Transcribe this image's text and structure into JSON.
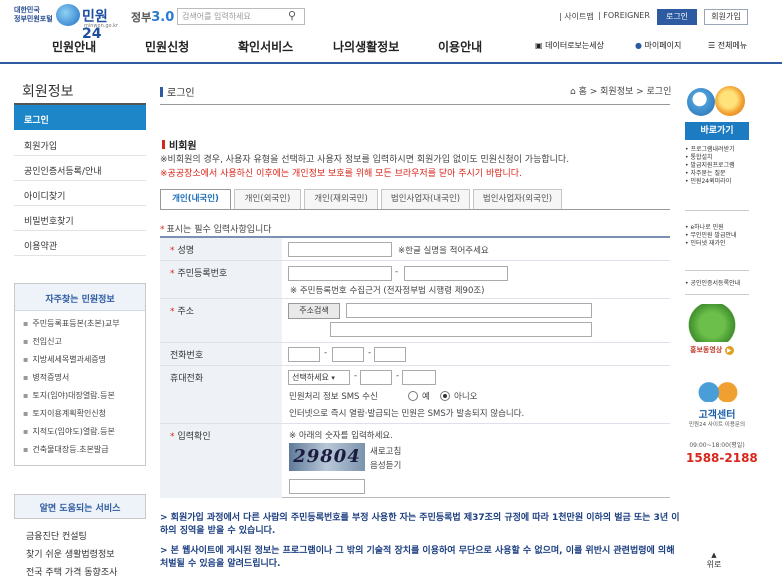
{
  "header": {
    "logo_small": "대한민국\n정부민원포털",
    "logo_text": "민원24",
    "logo_sub": "minwon.go.kr",
    "gov30_prefix": "정부",
    "gov30_mark": "3.0",
    "search_placeholder": "검색어를 입력하세요",
    "util_links": [
      "사이트맵",
      "FOREIGNER"
    ],
    "login_label": "로그인",
    "join_label": "회원가입"
  },
  "gnb": {
    "items": [
      "민원안내",
      "민원신청",
      "확인서비스",
      "나의생활정보",
      "이용안내"
    ],
    "util": [
      "데이터로보는세상",
      "마이페이지",
      "전체메뉴"
    ]
  },
  "lnb": {
    "title": "회원정보",
    "items": [
      "로그인",
      "회원가입",
      "공인인증서등록/안내",
      "아이디찾기",
      "비밀번호찾기",
      "이용약관"
    ],
    "active_index": 0,
    "box1_title": "자주찾는 민원정보",
    "box1_items": [
      "주민등록표등본(초본)교부",
      "전입신고",
      "지방세세목별과세증명",
      "병적증명서",
      "토지(임야)대장열람.등본",
      "토지이용계획확인신청",
      "지적도(임야도)열람.등본",
      "건축물대장등.초본발급"
    ],
    "box2_title": "알면 도움되는 서비스",
    "box2_items": [
      "금융진단 컨설팅",
      "찾기 쉬운 생활법령정보",
      "전국 주택 가격 동향조사"
    ]
  },
  "content": {
    "page_title": "로그인",
    "breadcrumb": "홈 > 회원정보 > 로그인",
    "section_title": "비회원",
    "desc1": "※비회원의 경우, 사용자 유형을 선택하고 사용자 정보를 입력하시면 회원가입 없이도 민원신청이 가능합니다.",
    "desc2": "※공공장소에서 사용하신 이후에는 개인정보 보호를 위해 모든 브라우저를 닫아 주시기 바랍니다.",
    "tabs": [
      "개인(내국인)",
      "개인(외국인)",
      "개인(재외국민)",
      "법인사업자(내국인)",
      "법인사업자(외국인)"
    ],
    "active_tab": 0,
    "req_note": "표시는 필수 입력사항입니다",
    "fields": {
      "name_label": "성명",
      "name_hint": "※한글 실명을 적어주세요",
      "rrn_label": "주민등록번호",
      "rrn_hint": "※ 주민등록번호 수집근거 (전자정부법 시행령 제90조)",
      "addr_label": "주소",
      "addr_button": "주소검색",
      "phone_label": "전화번호",
      "mobile_label": "휴대전화",
      "mobile_select": "선택하세요",
      "sms_label": "민원처리 정보 SMS 수신",
      "sms_yes": "예",
      "sms_no": "아니오",
      "sms_hint": "인터넷으로 즉시 열람·발급되는 민원은 SMS가 발송되지 않습니다.",
      "captcha_label": "입력확인",
      "captcha_hint": "※ 아래의 숫자를 입력하세요.",
      "captcha_text": "29804",
      "captcha_refresh": "새로고침",
      "captcha_audio": "음성듣기"
    },
    "notice1": "> 회원가입 과정에서 다른 사람의 주민등록번호를 부정 사용한 자는 주민등록법 제37조의 규정에 따라 1천만원 이하의 벌금 또는 3년 이하의 징역을 받을 수 있습니다.",
    "notice2": "> 본 웹사이트에 게시된 정보는 프로그램이나 그 밖의 기술적 장치를 이용하여 무단으로 사용할 수 없으며, 이를 위반시 관련법령에 의해 처벌될 수 있음을 알려드립니다."
  },
  "right": {
    "quick_title": "바로가기",
    "list1": [
      "프로그램내려받기",
      "통합설치",
      "발급지원프로그램",
      "자주묻는 질문",
      "민원24퀵미라이"
    ],
    "list2": [
      "e하나로 민원",
      "무인민원 발급안내",
      "인터넷 재가인"
    ],
    "list3": "공인인증서등록안내",
    "promo_label": "홍보동영상",
    "center_title": "고객센터",
    "center_sub": "민원24 사이트 이용문의",
    "center_hours": "09:00~18:00(평일)",
    "center_phone": "1588-2188",
    "top_label": "위로"
  }
}
